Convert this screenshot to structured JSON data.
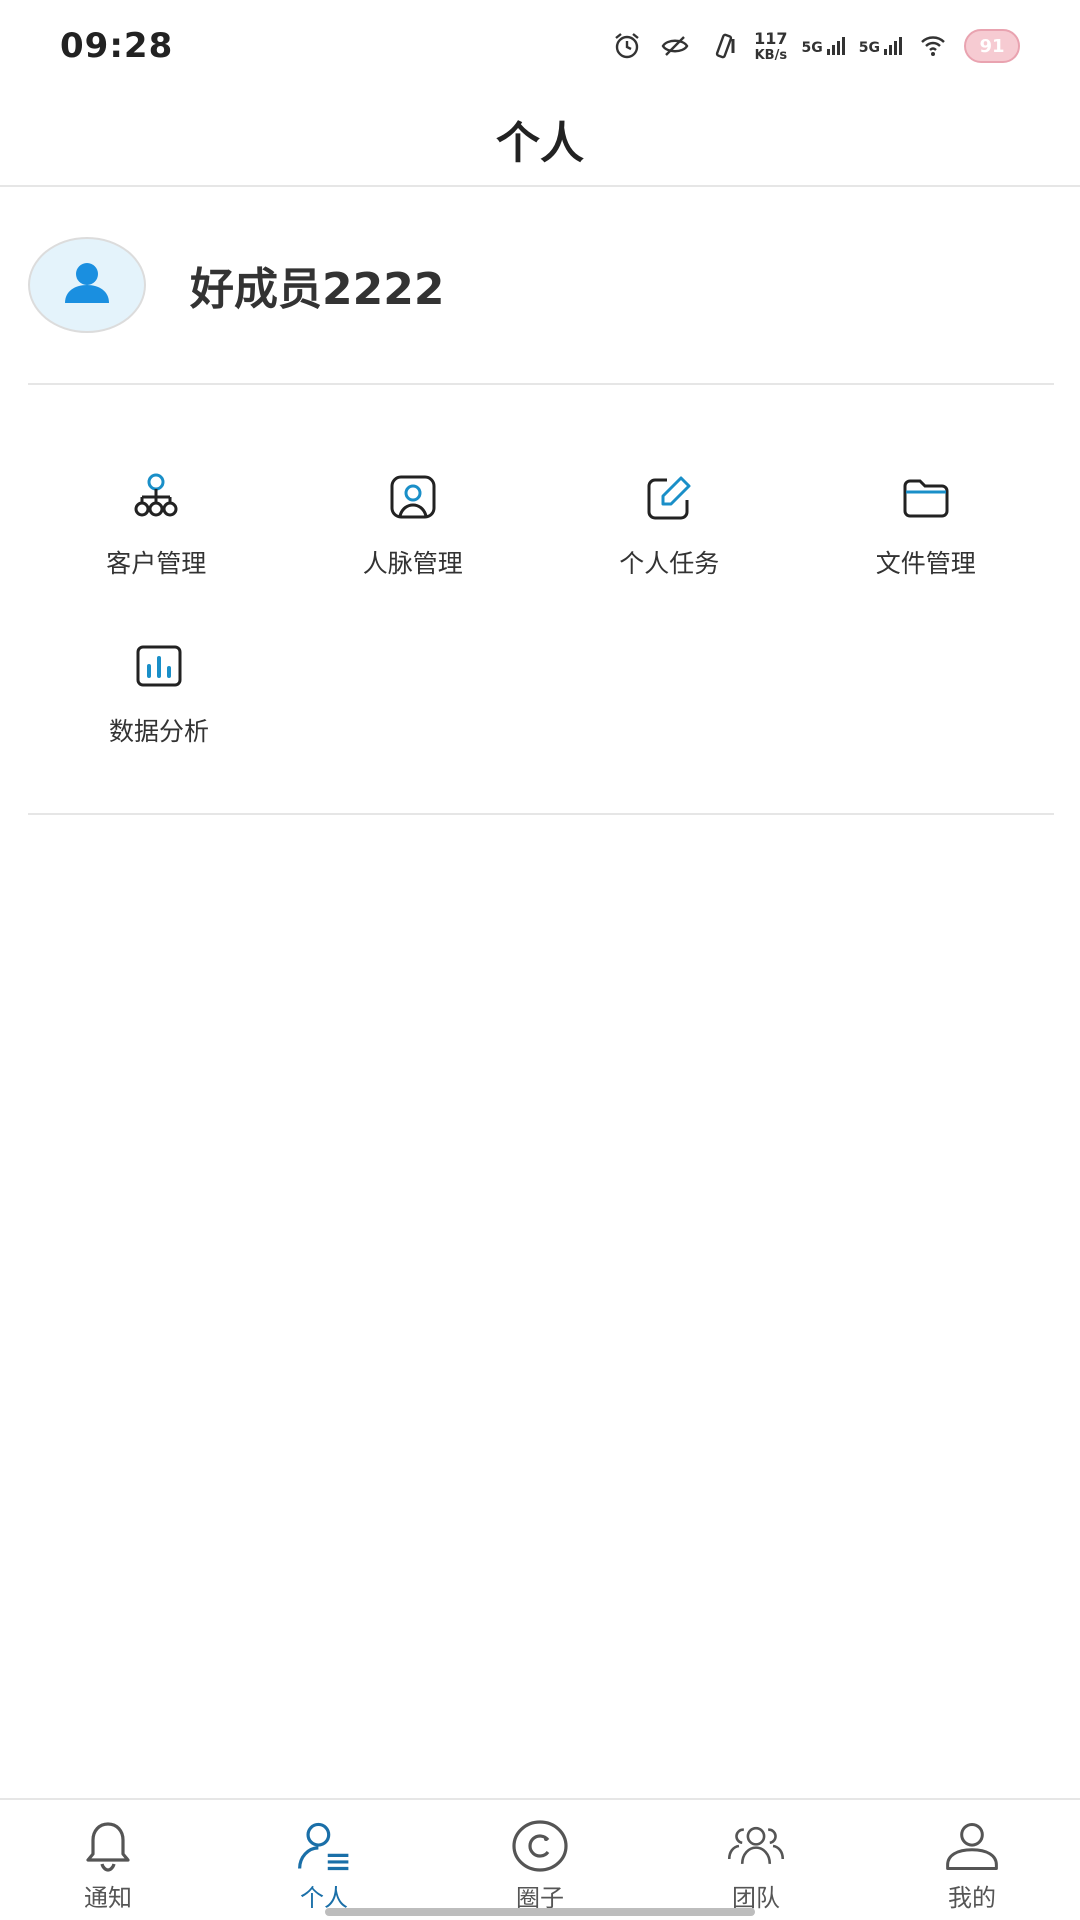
{
  "status_bar": {
    "time": "09:28",
    "speed_value": "117",
    "speed_unit": "KB/s",
    "sim1_label": "5G",
    "sim2_label": "5G",
    "battery": "91",
    "icons": [
      "alarm-icon",
      "eye-slash-icon",
      "vibrate-icon",
      "wifi-icon"
    ]
  },
  "header": {
    "title": "个人"
  },
  "profile": {
    "username": "好成员2222",
    "avatar_icon": "user-icon",
    "avatar_color": "#1a8fe0"
  },
  "menu": {
    "items": [
      {
        "label": "客户管理",
        "icon": "org-chart-icon"
      },
      {
        "label": "人脉管理",
        "icon": "contact-card-icon"
      },
      {
        "label": "个人任务",
        "icon": "edit-icon"
      },
      {
        "label": "文件管理",
        "icon": "folder-icon"
      },
      {
        "label": "数据分析",
        "icon": "bar-chart-icon"
      }
    ],
    "accent_color": "#1a8fc8"
  },
  "bottom_nav": {
    "items": [
      {
        "label": "通知",
        "icon": "bell-icon",
        "active": false
      },
      {
        "label": "个人",
        "icon": "person-list-icon",
        "active": true
      },
      {
        "label": "圈子",
        "icon": "circle-icon",
        "active": false
      },
      {
        "label": "团队",
        "icon": "team-icon",
        "active": false
      },
      {
        "label": "我的",
        "icon": "profile-icon",
        "active": false
      }
    ],
    "active_color": "#1a6fa8"
  }
}
